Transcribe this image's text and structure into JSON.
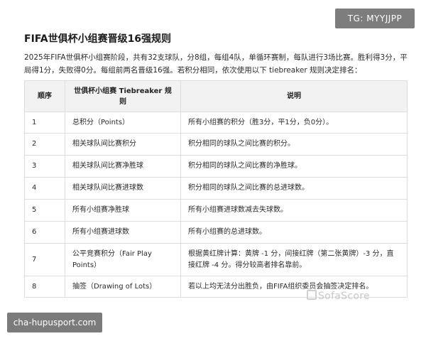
{
  "badges": {
    "top_right": "TG: MYYJJPP",
    "bottom_left": "cha-hupusport.com"
  },
  "title": "FIFA世俱杯小组赛晋级16强规则",
  "intro": "2025年FIFA世俱杯小组赛阶段，共有32支球队，分8组，每组4队，单循环赛制，每队进行3场比赛。胜利得3分，平局得1分，失败得0分。每组前两名晋级16强。若积分相同，依次使用以下 tiebreaker 规则决定排名：",
  "table": {
    "headers": {
      "no": "顺序",
      "rule": "世俱杯小组赛 Tiebreaker 规则",
      "desc": "说明"
    },
    "rows": [
      {
        "no": "1",
        "rule": "总积分（Points）",
        "desc": "所有小组赛的积分（胜3分，平1分，负0分）。"
      },
      {
        "no": "2",
        "rule": "相关球队间比赛积分",
        "desc": "积分相同的球队之间比赛的积分。"
      },
      {
        "no": "3",
        "rule": "相关球队间比赛净胜球",
        "desc": "积分相同的球队之间比赛的净胜球。"
      },
      {
        "no": "4",
        "rule": "相关球队间比赛进球数",
        "desc": "积分相同的球队之间比赛的总进球数。"
      },
      {
        "no": "5",
        "rule": "所有小组赛净胜球",
        "desc": "所有小组赛进球数减去失球数。"
      },
      {
        "no": "6",
        "rule": "所有小组赛进球数",
        "desc": "所有小组赛的总进球数。"
      },
      {
        "no": "7",
        "rule": "公平竞赛积分（Fair Play Points）",
        "desc": "根据黄红牌计算：黄牌 -1 分，间接红牌（第二张黄牌）-3 分，直接红牌 -4 分。得分较高者排名靠前。"
      },
      {
        "no": "8",
        "rule": "抽签（Drawing of Lots）",
        "desc": "若以上均无法分出胜负，由FIFA组织委员会抽签决定排名。"
      }
    ]
  },
  "watermark": "SofaScore"
}
